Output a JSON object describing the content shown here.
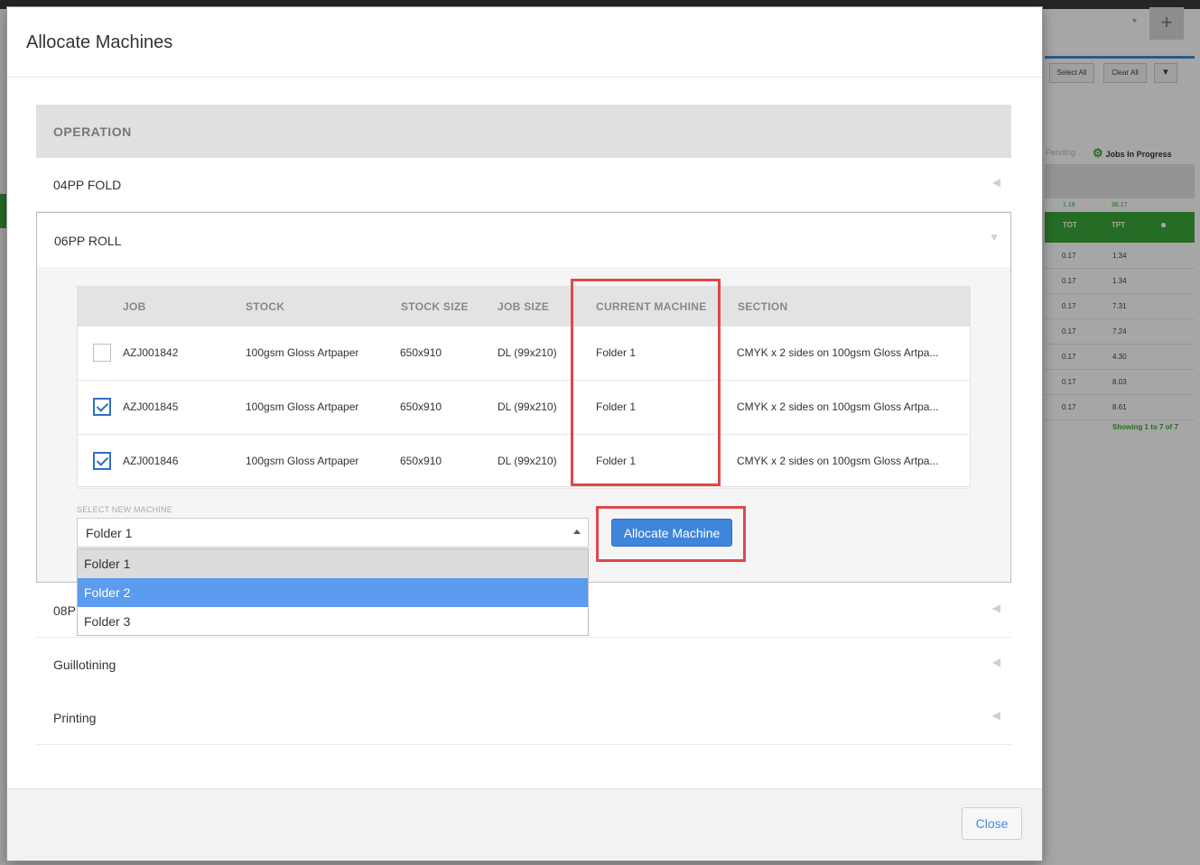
{
  "modal": {
    "title": "Allocate Machines",
    "close_label": "Close"
  },
  "operations": {
    "header": "OPERATION",
    "rows": [
      {
        "label": "04PP FOLD"
      },
      {
        "label": "06PP ROLL"
      },
      {
        "label": "08PP FOLD (partially hidden by dropdown)",
        "visible_label": "08P"
      },
      {
        "label": "Guillotining"
      },
      {
        "label": "Printing"
      }
    ]
  },
  "job_table": {
    "columns": [
      "JOB",
      "STOCK",
      "STOCK SIZE",
      "JOB SIZE",
      "CURRENT MACHINE",
      "SECTION"
    ],
    "rows": [
      {
        "checked": false,
        "job": "AZJ001842",
        "stock": "100gsm Gloss Artpaper",
        "stock_size": "650x910",
        "job_size": "DL (99x210)",
        "current_machine": "Folder 1",
        "section": "CMYK x 2 sides on 100gsm Gloss Artpa..."
      },
      {
        "checked": true,
        "job": "AZJ001845",
        "stock": "100gsm Gloss Artpaper",
        "stock_size": "650x910",
        "job_size": "DL (99x210)",
        "current_machine": "Folder 1",
        "section": "CMYK x 2 sides on 100gsm Gloss Artpa..."
      },
      {
        "checked": true,
        "job": "AZJ001846",
        "stock": "100gsm Gloss Artpaper",
        "stock_size": "650x910",
        "job_size": "DL (99x210)",
        "current_machine": "Folder 1",
        "section": "CMYK x 2 sides on 100gsm Gloss Artpa..."
      }
    ]
  },
  "machine_select": {
    "label": "SELECT NEW MACHINE",
    "value": "Folder 1",
    "options": [
      "Folder 1",
      "Folder 2",
      "Folder 3"
    ],
    "highlighted": "Folder 2"
  },
  "allocate_label": "Allocate Machine",
  "background": {
    "select_all": "Select All",
    "clear_all": "Clear All",
    "tab_pending": "Pending",
    "tab_progress": "Jobs In Progress",
    "sum1": "1.19",
    "sum2": "36.17",
    "col_tot": "TOT",
    "col_tpt": "TPT",
    "rows": [
      {
        "tot": "0.17",
        "tpt": "1.34"
      },
      {
        "tot": "0.17",
        "tpt": "1.34"
      },
      {
        "tot": "0.17",
        "tpt": "7.31"
      },
      {
        "tot": "0.17",
        "tpt": "7.24"
      },
      {
        "tot": "0.17",
        "tpt": "4.30"
      },
      {
        "tot": "0.17",
        "tpt": "8.03"
      },
      {
        "tot": "0.17",
        "tpt": "8.61"
      }
    ],
    "showing": "Showing 1 to 7 of 7"
  },
  "colors": {
    "accent": "#3f86da",
    "highlight_red": "#e04848",
    "green": "#3aa63a"
  }
}
